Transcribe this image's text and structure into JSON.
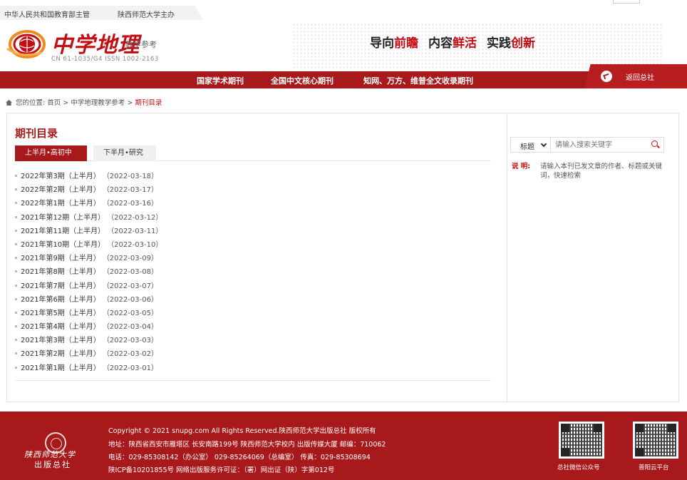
{
  "topbar": {
    "left_text": "中华人民共和国教育部主管",
    "right_text": "陕西师范大学主办"
  },
  "header": {
    "logo_title": "中学地理",
    "logo_subtitle": "教学参考",
    "logo_codes": "CN 61-1035/G4   ISSN 1002-2163",
    "slogan_parts": [
      "导向",
      "前瞻",
      "内容",
      "鲜活",
      "实践",
      "创新"
    ]
  },
  "nav": {
    "items": [
      "国家学术期刊",
      "全国中文核心期刊",
      "知网、万方、维普全文收录期刊"
    ],
    "return_label": "返回总社"
  },
  "breadcrumb": {
    "prefix": "您的位置:",
    "home": "首页",
    "section": "中学地理教学参考",
    "current": "期刊目录",
    "separator": ">"
  },
  "main": {
    "title": "期刊目录",
    "tabs": [
      {
        "label": "上半月•高初中",
        "active": true
      },
      {
        "label": "下半月•研究",
        "active": false
      }
    ],
    "issues": [
      {
        "label": "2022年第3期（上半月）",
        "date": "（2022-03-18）"
      },
      {
        "label": "2022年第2期（上半月）",
        "date": "（2022-03-17）"
      },
      {
        "label": "2022年第1期（上半月）",
        "date": "（2022-03-16）"
      },
      {
        "label": "2021年第12期（上半月）",
        "date": "（2022-03-12）"
      },
      {
        "label": "2021年第11期（上半月）",
        "date": "（2022-03-11）"
      },
      {
        "label": "2021年第10期（上半月）",
        "date": "（2022-03-10）"
      },
      {
        "label": "2021年第9期（上半月）",
        "date": "（2022-03-09）"
      },
      {
        "label": "2021年第8期（上半月）",
        "date": "（2022-03-08）"
      },
      {
        "label": "2021年第7期（上半月）",
        "date": "（2022-03-07）"
      },
      {
        "label": "2021年第6期（上半月）",
        "date": "（2022-03-06）"
      },
      {
        "label": "2021年第5期（上半月）",
        "date": "（2022-03-05）"
      },
      {
        "label": "2021年第4期（上半月）",
        "date": "（2022-03-04）"
      },
      {
        "label": "2021年第3期（上半月）",
        "date": "（2022-03-03）"
      },
      {
        "label": "2021年第2期（上半月）",
        "date": "（2022-03-02）"
      },
      {
        "label": "2021年第1期（上半月）",
        "date": "（2022-03-01）"
      }
    ]
  },
  "sidebar": {
    "search_field": "标题",
    "search_placeholder": "请输入搜索关键字",
    "note_label": "说 明:",
    "note_text": "请输入本刊已发文章的作者、标题或关键词，快速检索"
  },
  "footer": {
    "publisher_line1": "陕西师范大学",
    "publisher_line2": "出版总社",
    "lines": [
      "Copyright © 2021 snupg.com All Rights Reserved.陕西师范大学出版总社 版权所有",
      "地址：陕西省西安市雁塔区 长安南路199号 陕西师范大学校内 出版传媒大厦    邮编：710062",
      "电话：029-85308142（办公室）  029-85264069（总编室）    传真：029-85308694",
      "陕ICP备10201855号   网络出版服务许可证：（署）网出证（陕）字第012号"
    ],
    "qr_labels": [
      "总社微信公众号",
      "普阳云平台"
    ]
  },
  "colors": {
    "brand_red": "#a8191b",
    "accent_red": "#c40d12"
  }
}
